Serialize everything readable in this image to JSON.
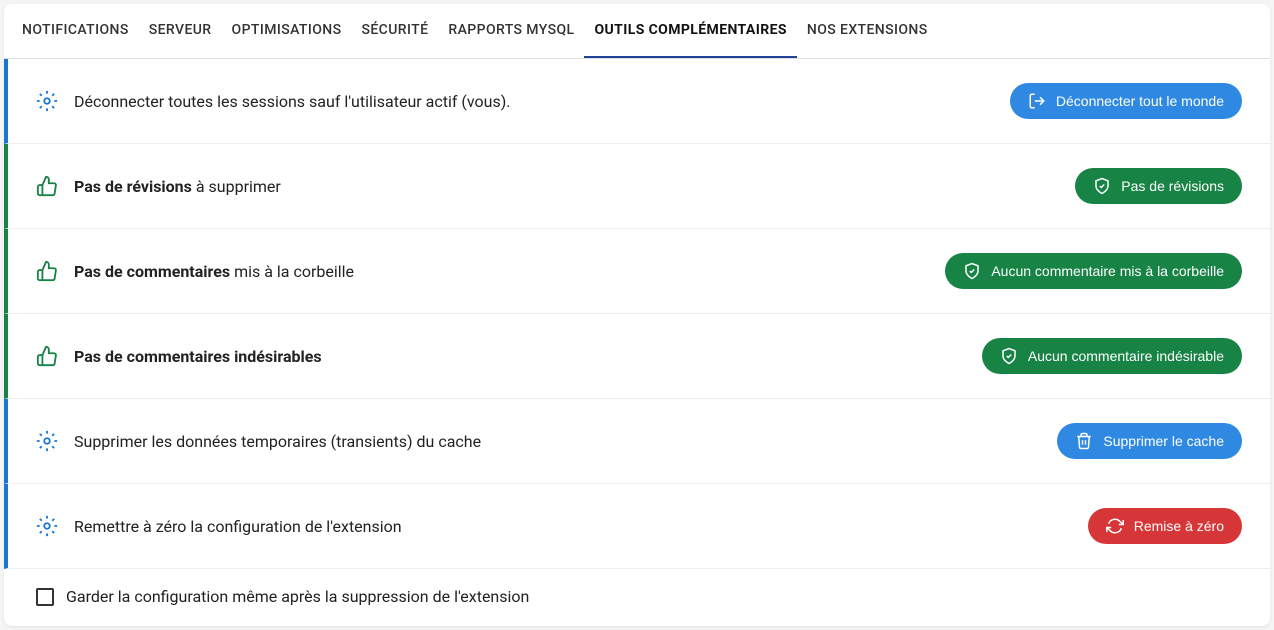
{
  "tabs": [
    {
      "label": "NOTIFICATIONS",
      "active": false
    },
    {
      "label": "SERVEUR",
      "active": false
    },
    {
      "label": "OPTIMISATIONS",
      "active": false
    },
    {
      "label": "SÉCURITÉ",
      "active": false
    },
    {
      "label": "RAPPORTS MYSQL",
      "active": false
    },
    {
      "label": "OUTILS COMPLÉMENTAIRES",
      "active": true
    },
    {
      "label": "NOS EXTENSIONS",
      "active": false
    }
  ],
  "rows": {
    "disconnect": {
      "text": "Déconnecter toutes les sessions sauf l'utilisateur actif (vous).",
      "button": "Déconnecter tout le monde"
    },
    "revisions": {
      "strong": "Pas de révisions",
      "rest": " à supprimer",
      "button": "Pas de révisions"
    },
    "comments_trash": {
      "strong": "Pas de commentaires",
      "rest": " mis à la corbeille",
      "button": "Aucun commentaire mis à la corbeille"
    },
    "comments_spam": {
      "strong": "Pas de commentaires indésirables",
      "rest": "",
      "button": "Aucun commentaire indésirable"
    },
    "transients": {
      "text": "Supprimer les données temporaires (transients) du cache",
      "button": "Supprimer le cache"
    },
    "reset": {
      "text": "Remettre à zéro la configuration de l'extension",
      "button": "Remise à zéro"
    },
    "keep_config": {
      "label": "Garder la configuration même après la suppression de l'extension"
    }
  }
}
